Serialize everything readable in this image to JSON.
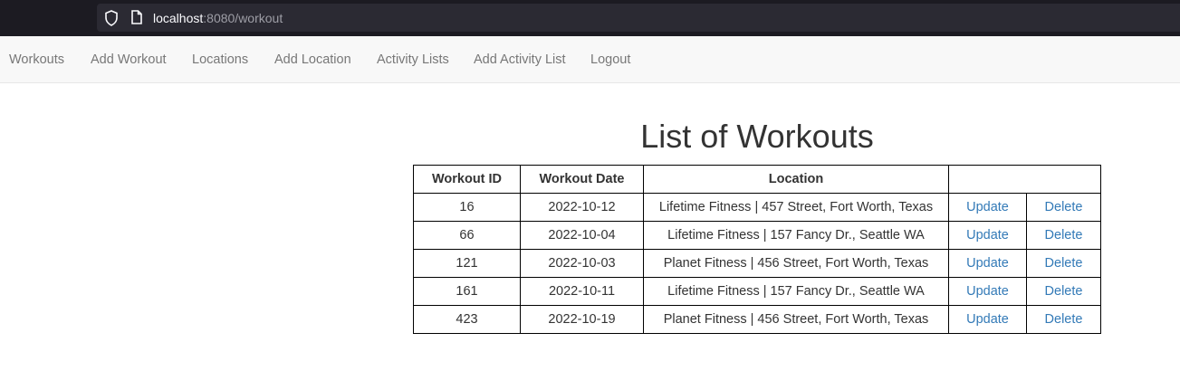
{
  "browser": {
    "url_host": "localhost",
    "url_rest": ":8080/workout"
  },
  "nav": {
    "items": [
      {
        "label": "Workouts"
      },
      {
        "label": "Add Workout"
      },
      {
        "label": "Locations"
      },
      {
        "label": "Add Location"
      },
      {
        "label": "Activity Lists"
      },
      {
        "label": "Add Activity List"
      },
      {
        "label": "Logout"
      }
    ]
  },
  "main": {
    "title": "List of Workouts",
    "table": {
      "headers": [
        "Workout ID",
        "Workout Date",
        "Location",
        ""
      ],
      "rows": [
        {
          "id": "16",
          "date": "2022-10-12",
          "location": "Lifetime Fitness | 457 Street, Fort Worth, Texas",
          "update": "Update",
          "delete": "Delete"
        },
        {
          "id": "66",
          "date": "2022-10-04",
          "location": "Lifetime Fitness | 157 Fancy Dr., Seattle WA",
          "update": "Update",
          "delete": "Delete"
        },
        {
          "id": "121",
          "date": "2022-10-03",
          "location": "Planet Fitness | 456 Street, Fort Worth, Texas",
          "update": "Update",
          "delete": "Delete"
        },
        {
          "id": "161",
          "date": "2022-10-11",
          "location": "Lifetime Fitness | 157 Fancy Dr., Seattle WA",
          "update": "Update",
          "delete": "Delete"
        },
        {
          "id": "423",
          "date": "2022-10-19",
          "location": "Planet Fitness | 456 Street, Fort Worth, Texas",
          "update": "Update",
          "delete": "Delete"
        }
      ]
    }
  },
  "colors": {
    "link": "#337ab7",
    "nav_text": "#777777",
    "navbar_bg": "#f8f8f8",
    "browser_bg": "#1c1b22"
  }
}
